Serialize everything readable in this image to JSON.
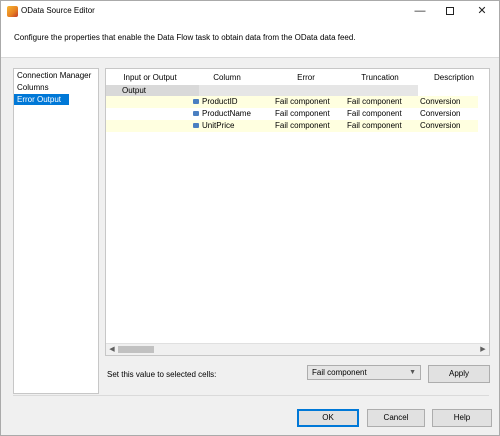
{
  "window": {
    "title": "OData Source Editor",
    "minimize": "—",
    "close": "✕"
  },
  "header": {
    "description": "Configure the properties that enable the Data Flow task to obtain data from the OData data feed."
  },
  "nav": {
    "items": [
      {
        "label": "Connection Manager",
        "selected": false
      },
      {
        "label": "Columns",
        "selected": false
      },
      {
        "label": "Error Output",
        "selected": true
      }
    ]
  },
  "grid": {
    "headers": [
      "Input or Output",
      "Column",
      "Error",
      "Truncation",
      "Description"
    ],
    "output_label": "Output",
    "rows": [
      {
        "column": "ProductID",
        "error": "Fail component",
        "truncation": "Fail component",
        "description": "Conversion"
      },
      {
        "column": "ProductName",
        "error": "Fail component",
        "truncation": "Fail component",
        "description": "Conversion"
      },
      {
        "column": "UnitPrice",
        "error": "Fail component",
        "truncation": "Fail component",
        "description": "Conversion"
      }
    ]
  },
  "footer": {
    "set_value_label": "Set this value to selected cells:",
    "select_value": "Fail component",
    "apply_label": "Apply",
    "ok_label": "OK",
    "cancel_label": "Cancel",
    "help_label": "Help"
  },
  "colors": {
    "selection": "#0078d7",
    "row_highlight": "#ffffe0",
    "icon_blue": "#4a7fc1"
  }
}
